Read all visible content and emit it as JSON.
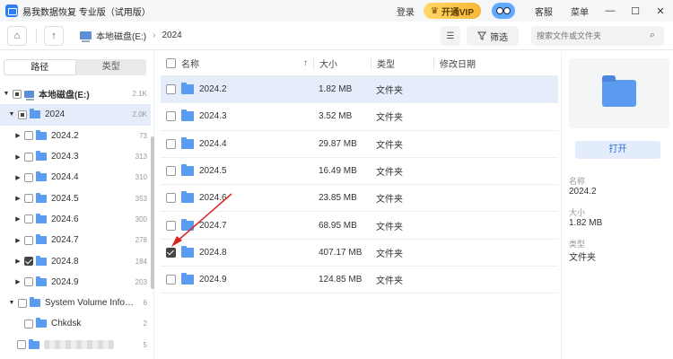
{
  "titlebar": {
    "app_title": "易我数据恢复 专业版（试用版）",
    "login": "登录",
    "vip": "开通VIP",
    "service": "客服",
    "menu": "菜单",
    "minimize": "—",
    "maximize": "☐",
    "close": "✕"
  },
  "toolbar": {
    "home_icon": "⌂",
    "up_icon": "↑",
    "path_drive": "本地磁盘(E:)",
    "path_sep": "›",
    "path_folder": "2024",
    "view_icon": "☰",
    "filter_label": "筛选",
    "search_placeholder": "搜索文件或文件夹",
    "search_icon": "⌕"
  },
  "sidebar": {
    "tab_path": "路径",
    "tab_type": "类型",
    "tree": [
      {
        "name": "本地磁盘(E:)",
        "count": "2.1K",
        "state": "partial",
        "expanded": true
      },
      {
        "name": "2024",
        "count": "2.0K",
        "state": "partial",
        "expanded": true
      },
      {
        "name": "2024.2",
        "count": "73",
        "state": "none"
      },
      {
        "name": "2024.3",
        "count": "313",
        "state": "none"
      },
      {
        "name": "2024.4",
        "count": "310",
        "state": "none"
      },
      {
        "name": "2024.5",
        "count": "353",
        "state": "none"
      },
      {
        "name": "2024.6",
        "count": "300",
        "state": "none"
      },
      {
        "name": "2024.7",
        "count": "278",
        "state": "none"
      },
      {
        "name": "2024.8",
        "count": "184",
        "state": "checked"
      },
      {
        "name": "2024.9",
        "count": "203",
        "state": "none"
      },
      {
        "name": "System Volume Informati...",
        "count": "6",
        "state": "none"
      },
      {
        "name": "Chkdsk",
        "count": "2",
        "state": "none"
      },
      {
        "name": "",
        "count": "5",
        "state": "none"
      }
    ]
  },
  "list": {
    "col_name": "名称",
    "col_size": "大小",
    "col_type": "类型",
    "col_date": "修改日期",
    "sort_icon": "↑",
    "rows": [
      {
        "name": "2024.2",
        "size": "1.82 MB",
        "type": "文件夹",
        "checked": false
      },
      {
        "name": "2024.3",
        "size": "3.52 MB",
        "type": "文件夹",
        "checked": false
      },
      {
        "name": "2024.4",
        "size": "29.87 MB",
        "type": "文件夹",
        "checked": false
      },
      {
        "name": "2024.5",
        "size": "16.49 MB",
        "type": "文件夹",
        "checked": false
      },
      {
        "name": "2024.6",
        "size": "23.85 MB",
        "type": "文件夹",
        "checked": false
      },
      {
        "name": "2024.7",
        "size": "68.95 MB",
        "type": "文件夹",
        "checked": false
      },
      {
        "name": "2024.8",
        "size": "407.17 MB",
        "type": "文件夹",
        "checked": true
      },
      {
        "name": "2024.9",
        "size": "124.85 MB",
        "type": "文件夹",
        "checked": false
      }
    ]
  },
  "detail": {
    "open_label": "打开",
    "name_label": "名称",
    "name_value": "2024.2",
    "size_label": "大小",
    "size_value": "1.82 MB",
    "type_label": "类型",
    "type_value": "文件夹"
  },
  "colors": {
    "accent": "#2d7df6",
    "selection": "#e5edfb",
    "annotation_arrow": "#e02020"
  }
}
